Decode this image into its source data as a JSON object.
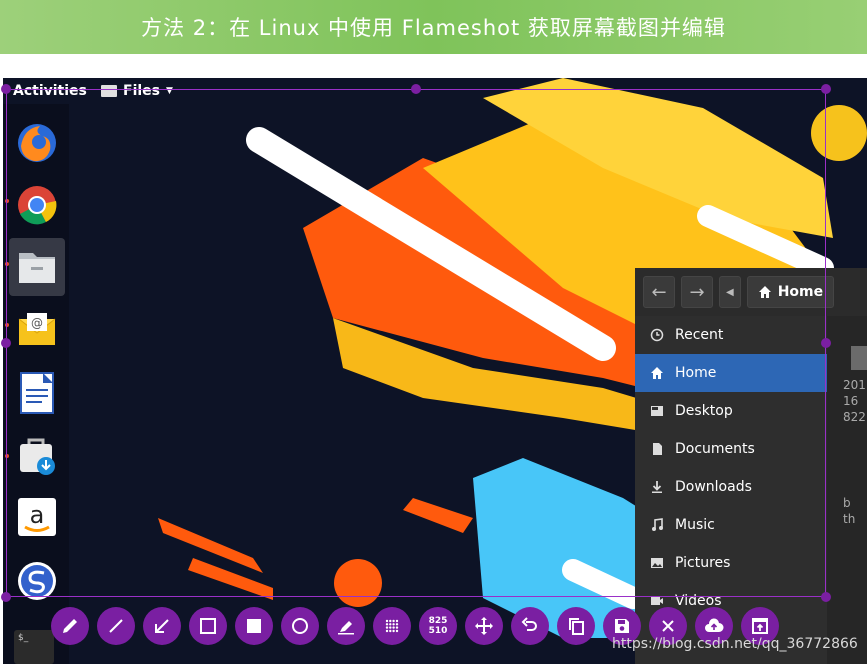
{
  "banner": {
    "title": "方法 2：在 Linux 中使用 Flameshot 获取屏幕截图并编辑"
  },
  "topbar": {
    "activities": "Activities",
    "files_menu": "Files"
  },
  "dock": [
    {
      "name": "firefox-icon"
    },
    {
      "name": "chrome-icon"
    },
    {
      "name": "files-app-icon",
      "active": true
    },
    {
      "name": "mail-icon"
    },
    {
      "name": "writer-icon"
    },
    {
      "name": "software-store-icon"
    },
    {
      "name": "amazon-icon"
    },
    {
      "name": "simplenote-icon"
    }
  ],
  "file_manager": {
    "location": "Home",
    "sidebar": [
      {
        "label": "Recent",
        "icon": "clock-icon"
      },
      {
        "label": "Home",
        "icon": "home-icon",
        "selected": true
      },
      {
        "label": "Desktop",
        "icon": "desktop-icon"
      },
      {
        "label": "Documents",
        "icon": "document-icon"
      },
      {
        "label": "Downloads",
        "icon": "download-icon"
      },
      {
        "label": "Music",
        "icon": "music-icon"
      },
      {
        "label": "Pictures",
        "icon": "pictures-icon"
      },
      {
        "label": "Videos",
        "icon": "video-icon"
      }
    ],
    "file_text": [
      "201",
      "16",
      "822"
    ],
    "file_text_lower": [
      "b",
      "th"
    ]
  },
  "toolbar": {
    "size_readout": [
      "825",
      "510"
    ],
    "tools": [
      "pencil",
      "line",
      "arrow",
      "rectangle",
      "filled-rectangle",
      "circle",
      "marker",
      "blur",
      "size",
      "move",
      "undo",
      "copy",
      "save",
      "exit",
      "upload",
      "open-app"
    ]
  },
  "terminal_label": "$_",
  "watermark": "https://blog.csdn.net/qq_36772866",
  "colors": {
    "accent": "#7a1fa2",
    "selection": "#2d67b5",
    "banner": "#7fc35a"
  }
}
